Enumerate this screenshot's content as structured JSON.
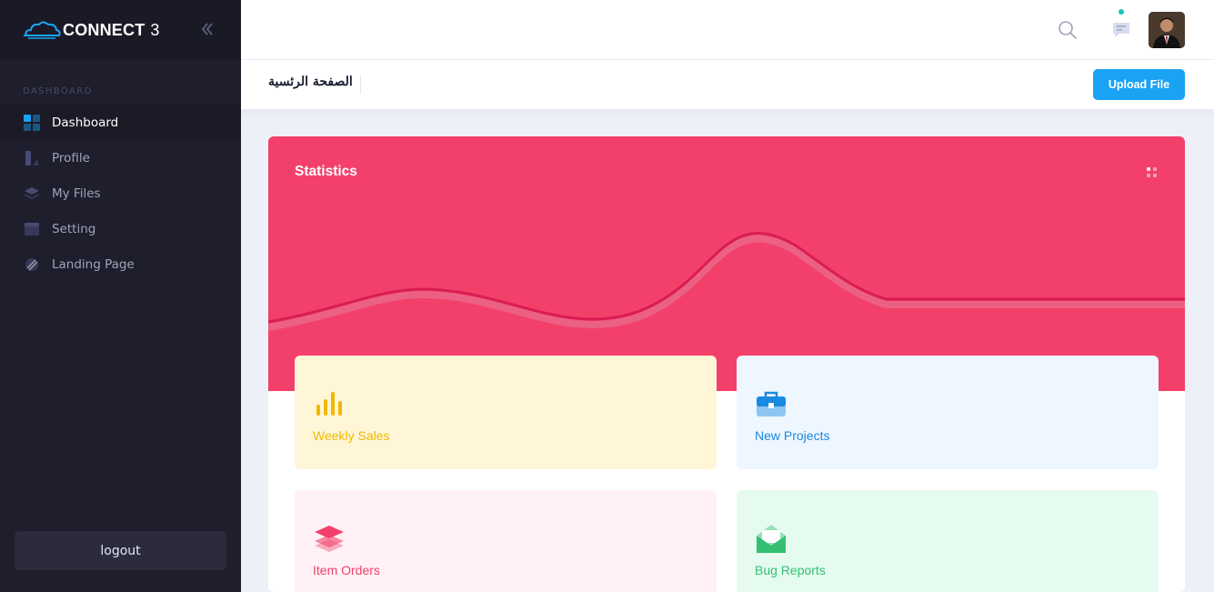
{
  "brand": {
    "name": "CONNECT",
    "number": "3",
    "logo_icon": "cloud-logo-icon",
    "collapse_icon": "double-chevron-left-icon"
  },
  "sidebar": {
    "section_label": "DASHBOARD",
    "items": [
      {
        "label": "Dashboard",
        "icon": "dashboard-grid-icon",
        "active": true
      },
      {
        "label": "Profile",
        "icon": "profile-icon",
        "active": false
      },
      {
        "label": "My Files",
        "icon": "layers-icon",
        "active": false
      },
      {
        "label": "Setting",
        "icon": "window-icon",
        "active": false
      },
      {
        "label": "Landing Page",
        "icon": "brush-icon",
        "active": false
      }
    ],
    "logout_label": "logout"
  },
  "topbar": {
    "search_icon": "search-icon",
    "chat_icon": "chat-icon",
    "avatar_icon": "user-avatar"
  },
  "subheader": {
    "page_title": "الصفحة الرئسية",
    "upload_label": "Upload File"
  },
  "statistics": {
    "title": "Statistics",
    "tiles": [
      {
        "label": "Weekly Sales",
        "icon": "bar-chart-icon",
        "color": "#f0b900"
      },
      {
        "label": "New Projects",
        "icon": "briefcase-icon",
        "color": "#1a8ae0"
      },
      {
        "label": "Item Orders",
        "icon": "layers-stack-icon",
        "color": "#f3406b"
      },
      {
        "label": "Bug Reports",
        "icon": "envelope-open-icon",
        "color": "#34bf73"
      }
    ]
  },
  "colors": {
    "accent": "#1ba3f3",
    "statistics_bg": "#f3406b",
    "sidebar_bg": "#1e1e2d"
  }
}
